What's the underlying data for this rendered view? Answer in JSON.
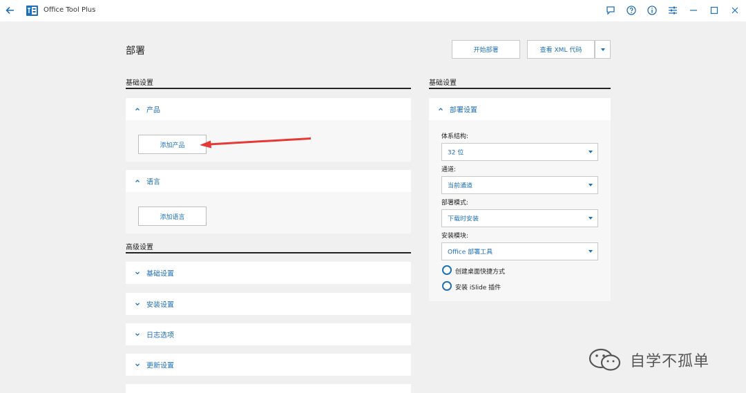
{
  "titlebar": {
    "title": "Office Tool Plus",
    "icons": [
      "back-arrow-icon",
      "app-logo-icon",
      "feedback-icon",
      "help-icon",
      "info-icon",
      "settings-sliders-icon",
      "minimize-icon",
      "maximize-icon",
      "close-icon"
    ]
  },
  "header": {
    "title": "部署",
    "start_deploy_label": "开始部署",
    "view_xml_label": "查看 XML 代码"
  },
  "left": {
    "basic_heading": "基础设置",
    "product_panel": {
      "label": "产品",
      "add_button": "添加产品"
    },
    "language_panel": {
      "label": "语言",
      "add_button": "添加语言"
    },
    "advanced_heading": "高级设置",
    "advanced_items": [
      "基础设置",
      "安装设置",
      "日志选项",
      "更新设置"
    ]
  },
  "right": {
    "heading": "基础设置",
    "panel_label": "部署设置",
    "fields": [
      {
        "label": "体系结构:",
        "value": "32 位"
      },
      {
        "label": "通道:",
        "value": "当前通道"
      },
      {
        "label": "部署模式:",
        "value": "下载时安装"
      },
      {
        "label": "安装模块:",
        "value": "Office 部署工具"
      }
    ],
    "options": [
      "创建桌面快捷方式",
      "安装 iSlide 插件"
    ]
  },
  "watermark": {
    "text": "自学不孤单"
  },
  "colors": {
    "accent": "#1e6fb8",
    "annotation_arrow": "#e53935",
    "background": "#f0f0f0"
  }
}
